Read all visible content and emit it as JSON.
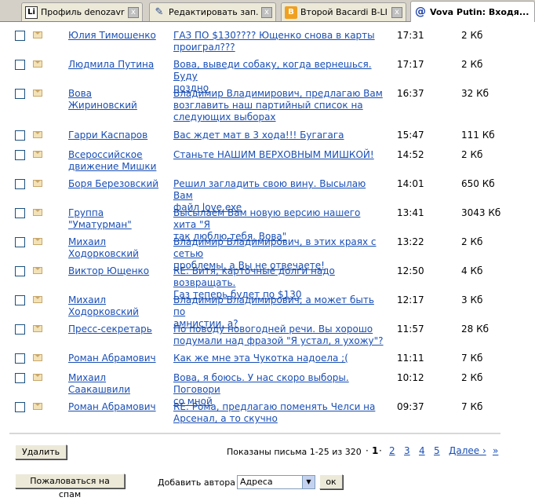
{
  "tabs": [
    {
      "icon": "li-icon",
      "title": "Профиль denozavre...",
      "close": "x"
    },
    {
      "icon": "pen-icon",
      "title": "Редактировать зап...",
      "close": "x"
    },
    {
      "icon": "bacardi-icon",
      "title": "Второй Bacardi B-LI...",
      "close": "x"
    },
    {
      "icon": "at-icon",
      "title": "Vova Putin: Входя...",
      "close": "x"
    }
  ],
  "messages": [
    {
      "sender": [
        "Юлия Тимошенко"
      ],
      "subject": [
        "ГАЗ ПО $130???? Ющенко снова в карты",
        "проиграл???"
      ],
      "time": "17:31",
      "size": "2 Кб"
    },
    {
      "sender": [
        "Людмила Путина"
      ],
      "subject": [
        "Вова, выведи собаку, когда вернешься. Буду",
        "поздно"
      ],
      "time": "17:17",
      "size": "2 Кб"
    },
    {
      "sender": [
        "Вова Жириновский"
      ],
      "subject": [
        "Владимир Владимирович, предлагаю Вам",
        "возглавить наш партийный список на",
        "следующих выборах"
      ],
      "time": "16:37",
      "size": "32 Кб"
    },
    {
      "sender": [
        "Гарри Каспаров"
      ],
      "subject": [
        "Вас ждет мат в 3 хода!!! Бугагага"
      ],
      "time": "15:47",
      "size": "111 Кб"
    },
    {
      "sender": [
        "Всероссийское",
        "движение Мишки"
      ],
      "subject": [
        "Станьте НАШИМ ВЕРХОВНЫМ МИШКОЙ!"
      ],
      "time": "14:52",
      "size": "2 Кб"
    },
    {
      "sender": [
        "Боря Березовский"
      ],
      "subject": [
        "Решил загладить свою вину. Высылаю Вам",
        "файл love.exe"
      ],
      "time": "14:01",
      "size": "650 Кб"
    },
    {
      "sender": [
        "Группа \"Уматурман\""
      ],
      "subject": [
        "Высылаем Вам новую версию нашего хита \"Я",
        "так люблю тебя, Вова\""
      ],
      "time": "13:41",
      "size": "3043 Кб"
    },
    {
      "sender": [
        "Михаил",
        "Ходорковский"
      ],
      "subject": [
        "Владимир Владимирович, в этих краях с сетью",
        "проблемы, а Вы не отвечаете!"
      ],
      "time": "13:22",
      "size": "2 Кб"
    },
    {
      "sender": [
        "Виктор Ющенко"
      ],
      "subject": [
        "RE: Витя, карточные долги надо возвращать.",
        "Газ теперь будет по $130"
      ],
      "time": "12:50",
      "size": "4 Кб"
    },
    {
      "sender": [
        "Михаил",
        "Ходорковский"
      ],
      "subject": [
        "Владимир Владимирович, а может быть по",
        "амнистии, а?"
      ],
      "time": "12:17",
      "size": "3 Кб"
    },
    {
      "sender": [
        "Пресс-секретарь"
      ],
      "subject": [
        "По поводу новогодней речи. Вы хорошо",
        "подумали над фразой \"Я устал, я ухожу\"?"
      ],
      "time": "11:57",
      "size": "28 Кб"
    },
    {
      "sender": [
        "Роман Абрамович"
      ],
      "subject": [
        "Как же мне эта Чукотка надоела ;("
      ],
      "time": "11:11",
      "size": "7 Кб"
    },
    {
      "sender": [
        "Михаил Саакашвили"
      ],
      "subject": [
        "Вова, я боюсь. У нас скоро выборы. Поговори",
        "со мной"
      ],
      "time": "10:12",
      "size": "2 Кб"
    },
    {
      "sender": [
        "Роман Абрамович"
      ],
      "subject": [
        "RE: Рома, предлагаю поменять Челси на",
        "Арсенал, а то скучно"
      ],
      "time": "09:37",
      "size": "7 Кб"
    }
  ],
  "footer": {
    "delete_label": "Удалить",
    "shown_text": "Показаны письма 1-25 из 320",
    "pager": {
      "bullet": "·",
      "current": "1",
      "pages": [
        "2",
        "3",
        "4",
        "5"
      ],
      "next": "Далее ›",
      "last": "»"
    },
    "spam_label": "Пожаловаться на спам",
    "add_author_label": "Добавить автора в",
    "select_value": "Адреса",
    "ok_label": "ок"
  }
}
